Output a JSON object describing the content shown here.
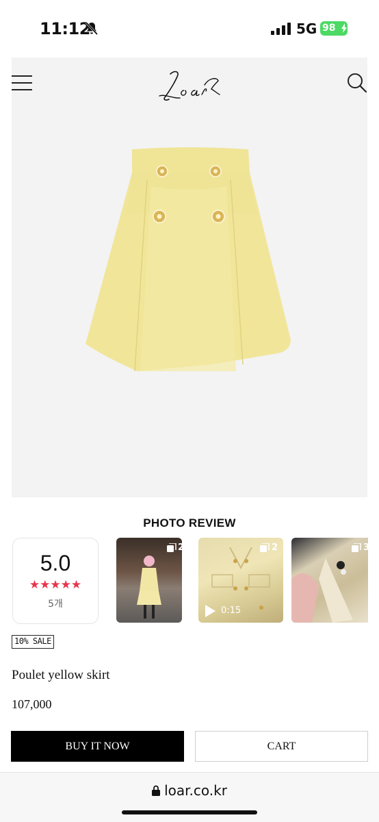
{
  "status_bar": {
    "time": "11:12",
    "network": "5G",
    "battery": "98"
  },
  "header": {
    "logo_alt": "Loar"
  },
  "photo_review": {
    "title": "PHOTO REVIEW",
    "rating": {
      "score": "5.0",
      "stars": "★★★★★",
      "count": "5개"
    },
    "thumbnails": [
      {
        "count": "2"
      },
      {
        "count": "2",
        "duration": "0:15"
      },
      {
        "count": "3"
      }
    ]
  },
  "product": {
    "sale_badge": "10% SALE",
    "name": "Poulet yellow skirt",
    "price": "107,000",
    "color": "#f1e59a"
  },
  "actions": {
    "buy_label": "BUY IT NOW",
    "cart_label": "CART"
  },
  "browser": {
    "url": "loar.co.kr"
  }
}
